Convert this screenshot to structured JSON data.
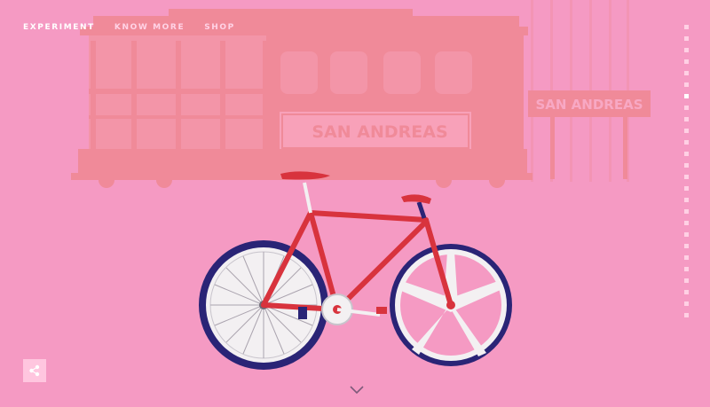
{
  "nav": {
    "items": [
      {
        "label": "EXPERIMENT",
        "active": true
      },
      {
        "label": "KNOW MORE",
        "active": false
      },
      {
        "label": "SHOP",
        "active": false
      }
    ]
  },
  "scene": {
    "tram_sign": "SAN ANDREAS",
    "station_sign": "SAN ANDREAS"
  },
  "pager": {
    "count": 26,
    "active_index": 6
  },
  "colors": {
    "background": "#f59ac3",
    "tram": "#f08a99",
    "frame": "#d8333d",
    "rim": "#2a2476",
    "wheel_white": "#f3f0f2"
  },
  "icons": {
    "share": "share-icon",
    "scroll": "chevron-down-icon"
  }
}
